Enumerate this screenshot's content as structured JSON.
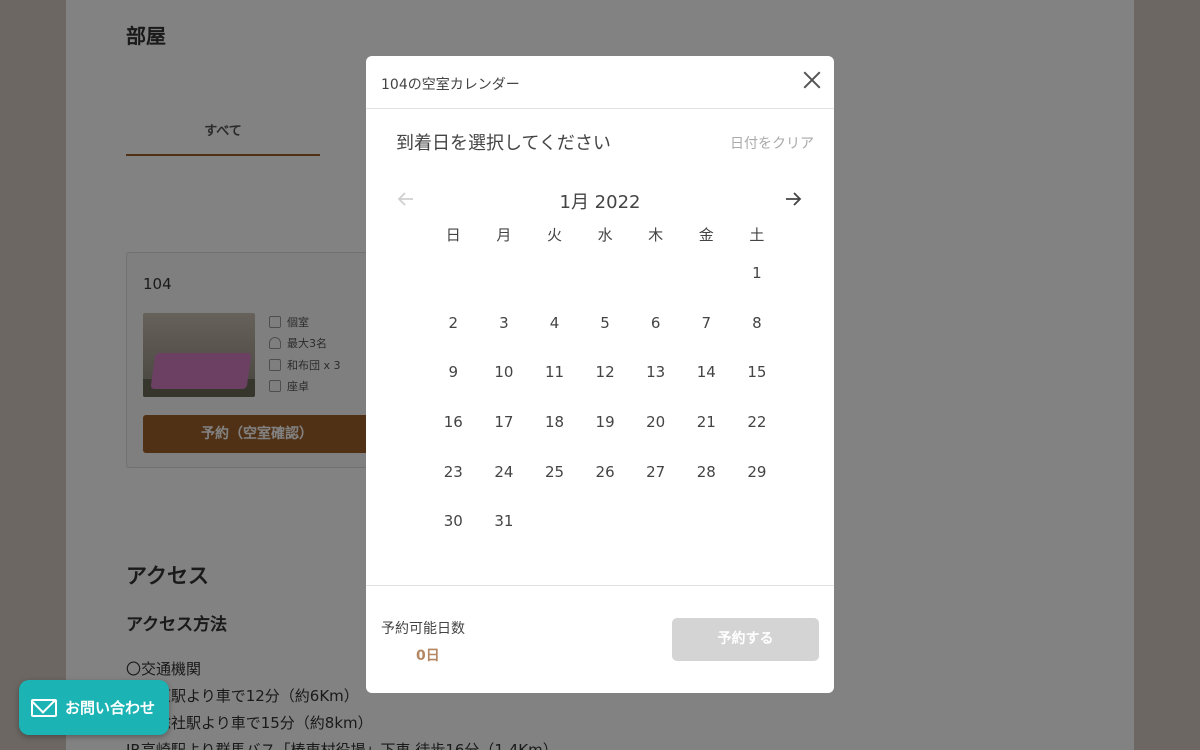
{
  "page": {
    "section_title": "部屋",
    "tabs": [
      {
        "label": "すべて"
      }
    ],
    "room": {
      "name": "104",
      "specs": [
        "個室",
        "最大3名",
        "和布団 x 3",
        "座卓"
      ],
      "book_button": "予約（空室確認）"
    },
    "access": {
      "title": "アクセス",
      "subtitle": "アクセス方法",
      "lines": [
        "〇交通機関",
        "　太原駅より車で12分（約6Km）",
        "　馬総社駅より車で15分（約8km）",
        "JR高崎駅より群馬バス「榛東村役場」下車 徒歩16分（1.4Km）"
      ]
    }
  },
  "contact_button": {
    "label": "お問い合わせ",
    "icon": "mail-icon"
  },
  "modal": {
    "title": "104の空室カレンダー",
    "instruction": "到着日を選択してください",
    "clear_label": "日付をクリア",
    "month_label": "1月 2022",
    "weekdays": [
      "日",
      "月",
      "火",
      "水",
      "木",
      "金",
      "土"
    ],
    "days": [
      "",
      "",
      "",
      "",
      "",
      "",
      "1",
      "2",
      "3",
      "4",
      "5",
      "6",
      "7",
      "8",
      "9",
      "10",
      "11",
      "12",
      "13",
      "14",
      "15",
      "16",
      "17",
      "18",
      "19",
      "20",
      "21",
      "22",
      "23",
      "24",
      "25",
      "26",
      "27",
      "28",
      "29",
      "30",
      "31"
    ],
    "available_label": "予約可能日数",
    "available_count": "0日",
    "reserve_button": "予約する"
  },
  "colors": {
    "accent": "#a0612a",
    "contact": "#1bb3b3",
    "disabled_button": "#d4d4d4",
    "count": "#b38764"
  }
}
